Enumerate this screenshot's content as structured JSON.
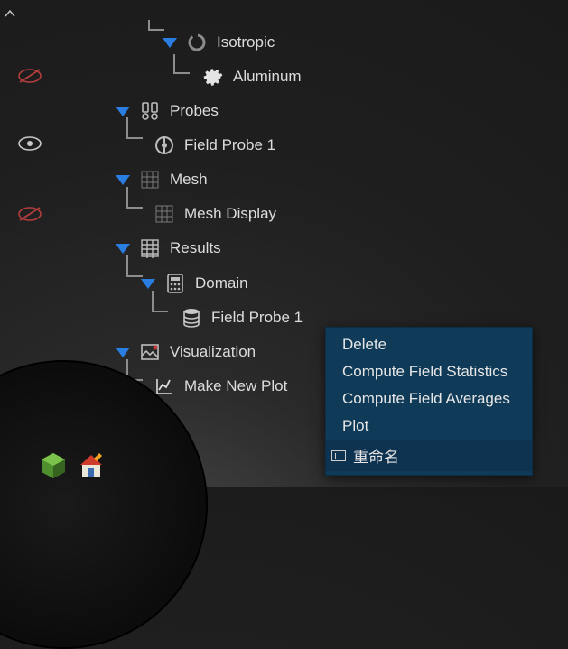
{
  "tree": {
    "isotropic": "Isotropic",
    "aluminum": "Aluminum",
    "probes": "Probes",
    "field_probe_1": "Field Probe 1",
    "mesh": "Mesh",
    "mesh_display": "Mesh Display",
    "results": "Results",
    "domain": "Domain",
    "results_field_probe_1": "Field Probe 1",
    "visualization": "Visualization",
    "make_new_plot": "Make New Plot"
  },
  "context_menu": {
    "delete": "Delete",
    "compute_stats": "Compute Field Statistics",
    "compute_avgs": "Compute Field Averages",
    "plot": "Plot",
    "rename": "重命名"
  }
}
